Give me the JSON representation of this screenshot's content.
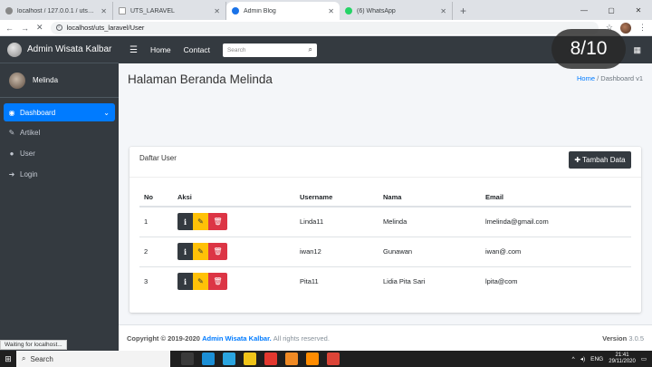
{
  "browser": {
    "tabs": [
      {
        "label": "localhost / 127.0.0.1 / uts_laravel",
        "active": false,
        "icon": "phpmyadmin-icon"
      },
      {
        "label": "UTS_LARAVEL",
        "active": false,
        "icon": "page-icon"
      },
      {
        "label": "Admin Blog",
        "active": true,
        "icon": "site-icon"
      },
      {
        "label": "(6) WhatsApp",
        "active": false,
        "icon": "whatsapp-icon"
      }
    ],
    "new_tab": "+",
    "address": "localhost/uts_laravel/User",
    "status_message": "Waiting for localhost..."
  },
  "app": {
    "brand": "Admin Wisata Kalbar",
    "nav": {
      "home": "Home",
      "contact": "Contact",
      "search_placeholder": "Search"
    }
  },
  "sidebar": {
    "user": "Melinda",
    "items": [
      {
        "label": "Dashboard",
        "icon": "dashboard-icon",
        "active": true
      },
      {
        "label": "Artikel",
        "icon": "edit-icon",
        "active": false
      },
      {
        "label": "User",
        "icon": "user-icon",
        "active": false
      },
      {
        "label": "Login",
        "icon": "sign-in-icon",
        "active": false
      }
    ]
  },
  "page": {
    "title": "Halaman Beranda Melinda",
    "breadcrumb": {
      "home": "Home",
      "separator": "/",
      "current": "Dashboard v1"
    }
  },
  "card": {
    "title": "Daftar User",
    "add_button": "Tambah Data",
    "columns": [
      "No",
      "Aksi",
      "Username",
      "Nama",
      "Email"
    ],
    "rows": [
      {
        "no": "1",
        "username": "Linda11",
        "nama": "Melinda",
        "email": "lmelinda@gmail.com"
      },
      {
        "no": "2",
        "username": "iwan12",
        "nama": "Gunawan",
        "email": "iwan@.com"
      },
      {
        "no": "3",
        "username": "Pita11",
        "nama": "Lidia Pita Sari",
        "email": "lpita@com"
      }
    ]
  },
  "footer": {
    "copyright": "Copyright © 2019-2020",
    "link": "Admin Wisata Kalbar.",
    "rights": "All rights reserved.",
    "version_label": "Version",
    "version": "3.0.5"
  },
  "overlay": {
    "counter": "8/10"
  },
  "taskbar": {
    "search": "Search",
    "time": "21:41",
    "date": "29/11/2020",
    "lang": "ENG"
  },
  "colors": {
    "primary": "#007bff",
    "dark": "#343a40",
    "warning": "#ffc107",
    "danger": "#dc3545"
  }
}
